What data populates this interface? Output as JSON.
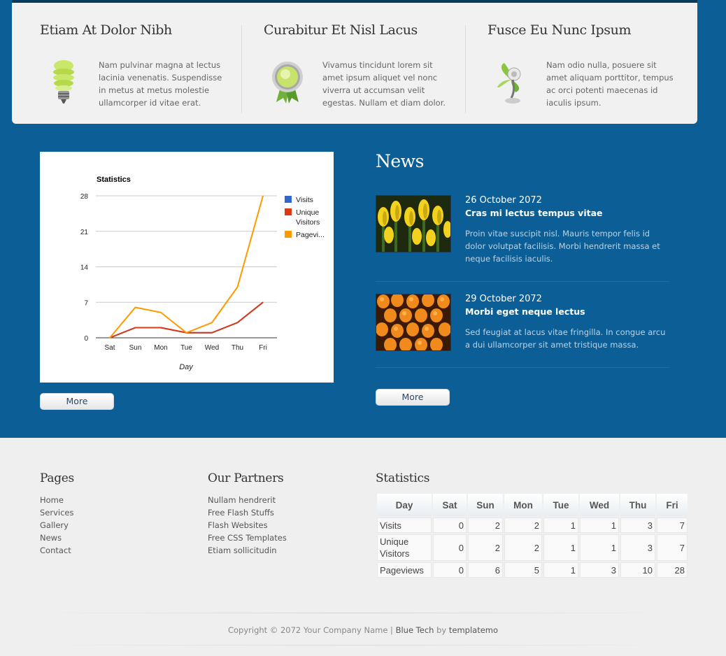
{
  "features": [
    {
      "title": "Etiam At Dolor Nibh",
      "icon": "lightbulb-icon",
      "text": "Nam pulvinar magna at lectus lacinia venenatis. Suspendisse in metus at metus molestie ullamcorper id vitae erat."
    },
    {
      "title": "Curabitur Et Nisl Lacus",
      "icon": "award-badge-icon",
      "text": "Vivamus tincidunt lorem sit amet ipsum aliquet vel nonc viverra ut accumsan velit egestas. Nullam et diam dolor."
    },
    {
      "title": "Fusce Eu Nunc Ipsum",
      "icon": "eco-fan-icon",
      "text": "Nam odio nulla, posuere sit amet aliquam porttitor, tempus ac orci potenti maecenas id iaculis ipsum."
    }
  ],
  "chart_data": {
    "type": "line",
    "title": "Statistics",
    "xlabel": "Day",
    "ylabel": "",
    "categories": [
      "Sat",
      "Sun",
      "Mon",
      "Tue",
      "Wed",
      "Thu",
      "Fri"
    ],
    "ylim": [
      0,
      28
    ],
    "yticks": [
      0,
      7,
      14,
      21,
      28
    ],
    "grid": true,
    "legend_position": "right",
    "series": [
      {
        "name": "Visits",
        "color": "#3366cc",
        "values": [
          0,
          2,
          2,
          1,
          1,
          3,
          7
        ]
      },
      {
        "name": "Unique Visitors",
        "color": "#dc3912",
        "values": [
          0,
          2,
          2,
          1,
          1,
          3,
          7
        ]
      },
      {
        "name": "Pagevi...",
        "color": "#ff9900",
        "values": [
          0,
          6,
          5,
          1,
          3,
          10,
          28
        ]
      }
    ]
  },
  "chart_more": "More",
  "news": {
    "title": "News",
    "items": [
      {
        "date": "26 October 2072",
        "headline": "Cras mi lectus tempus vitae",
        "body": "Proin vitae suscipit nisl. Mauris tempor felis id dolor volutpat facilisis. Morbi hendrerit massa et neque facilisis iaculis."
      },
      {
        "date": "29 October 2072",
        "headline": "Morbi eget neque lectus",
        "body": "Sed feugiat at lacus vitae fringilla. In congue arcu a dui ullamcorper sit amet tristique massa."
      }
    ],
    "more": "More"
  },
  "footer": {
    "pages": {
      "title": "Pages",
      "links": [
        "Home",
        "Services",
        "Gallery",
        "News",
        "Contact"
      ]
    },
    "partners": {
      "title": "Our Partners",
      "links": [
        "Nullam hendrerit",
        "Free Flash Stuffs",
        "Flash Websites",
        "Free CSS Templates",
        "Etiam sollicitudin"
      ]
    },
    "stats": {
      "title": "Statistics",
      "header": [
        "Day",
        "Sat",
        "Sun",
        "Mon",
        "Tue",
        "Wed",
        "Thu",
        "Fri"
      ],
      "rows": [
        {
          "label": "Visits",
          "values": [
            "0",
            "2",
            "2",
            "1",
            "1",
            "3",
            "7"
          ]
        },
        {
          "label": "Unique Visitors",
          "values": [
            "0",
            "2",
            "2",
            "1",
            "1",
            "3",
            "7"
          ]
        },
        {
          "label": "Pageviews",
          "values": [
            "0",
            "6",
            "5",
            "1",
            "3",
            "10",
            "28"
          ]
        }
      ]
    },
    "copyright": {
      "prefix": "Copyright © 2072 Your Company Name | ",
      "site": "Blue Tech",
      "by": " by ",
      "author": "templatemo"
    }
  }
}
